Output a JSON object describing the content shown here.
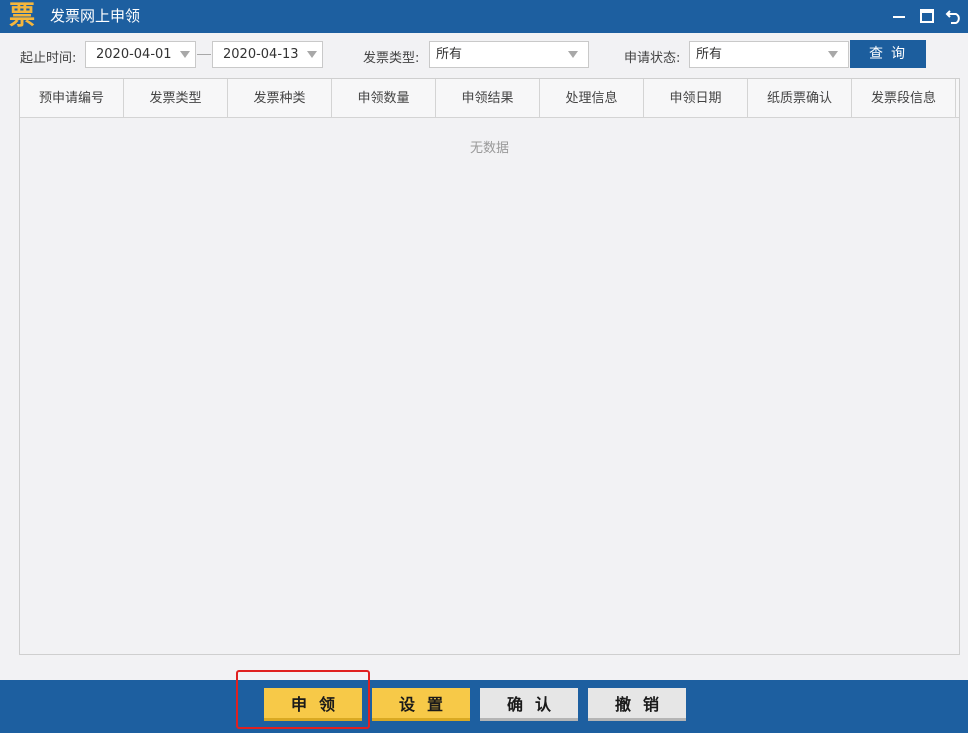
{
  "window": {
    "logo_char": "票",
    "title": "发票网上申领"
  },
  "filters": {
    "date_label": "起止时间:",
    "start_date": "2020-04-01",
    "end_date": "2020-04-13",
    "invoice_type_label": "发票类型:",
    "invoice_type_value": "所有",
    "status_label": "申请状态:",
    "status_value": "所有",
    "query_label": "查询"
  },
  "table": {
    "columns": [
      "预申请编号",
      "发票类型",
      "发票种类",
      "申领数量",
      "申领结果",
      "处理信息",
      "申领日期",
      "纸质票确认",
      "发票段信息"
    ],
    "empty_text": "无数据"
  },
  "actions": {
    "apply": "申领",
    "settings": "设置",
    "confirm": "确认",
    "cancel": "撤销"
  },
  "colors": {
    "titlebar": "#1d5fa0",
    "primary_button": "#f7c948",
    "secondary_button": "#e6e6e6",
    "highlight": "#e02020"
  }
}
